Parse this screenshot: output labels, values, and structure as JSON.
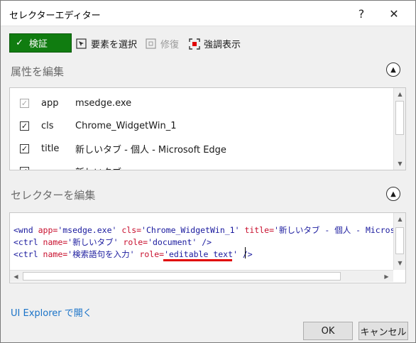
{
  "window": {
    "title": "セレクターエディター",
    "help_label": "?",
    "close_label": "✕"
  },
  "toolbar": {
    "validate_label": "検証",
    "select_element_label": "要素を選択",
    "repair_label": "修復",
    "highlight_label": "強調表示"
  },
  "attributes": {
    "section_title": "属性を編集",
    "rows": [
      {
        "name": "app",
        "value": "msedge.exe",
        "checked": true,
        "disabled": true
      },
      {
        "name": "cls",
        "value": "Chrome_WidgetWin_1",
        "checked": true,
        "disabled": false
      },
      {
        "name": "title",
        "value": "新しいタブ - 個人 - Microsoft Edge",
        "checked": true,
        "disabled": false
      },
      {
        "name": "",
        "value": "新しいタブ",
        "checked": true,
        "disabled": false
      }
    ]
  },
  "selector": {
    "section_title": "セレクターを編集",
    "lines": [
      [
        {
          "t": "<wnd ",
          "c": "tag"
        },
        {
          "t": "app=",
          "c": "an"
        },
        {
          "t": "'msedge.exe'",
          "c": "av"
        },
        {
          "t": " cls=",
          "c": "an"
        },
        {
          "t": "'Chrome_WidgetWin_1'",
          "c": "av"
        },
        {
          "t": " title=",
          "c": "an"
        },
        {
          "t": "'新しいタブ - 個人 - Microsoft",
          "c": "av"
        }
      ],
      [
        {
          "t": "<ctrl ",
          "c": "tag"
        },
        {
          "t": "name=",
          "c": "an"
        },
        {
          "t": "'新しいタブ'",
          "c": "av"
        },
        {
          "t": " role=",
          "c": "an"
        },
        {
          "t": "'document'",
          "c": "av"
        },
        {
          "t": " />",
          "c": "tag"
        }
      ],
      [
        {
          "t": "<ctrl ",
          "c": "tag"
        },
        {
          "t": "name=",
          "c": "an"
        },
        {
          "t": "'検索語句を入力'",
          "c": "av"
        },
        {
          "t": " role=",
          "c": "an"
        },
        {
          "t": "'editable text'",
          "c": "av"
        },
        {
          "t": " />",
          "c": "tag"
        }
      ]
    ]
  },
  "footer": {
    "explorer_link": "UI Explorer で開く",
    "ok_label": "OK",
    "cancel_label": "キャンセル"
  },
  "colors": {
    "validate_bg": "#107c10",
    "attr_name": "#c8102e",
    "attr_value": "#1a1a9e",
    "highlight_underline": "#e00000",
    "link": "#1a73c8"
  }
}
